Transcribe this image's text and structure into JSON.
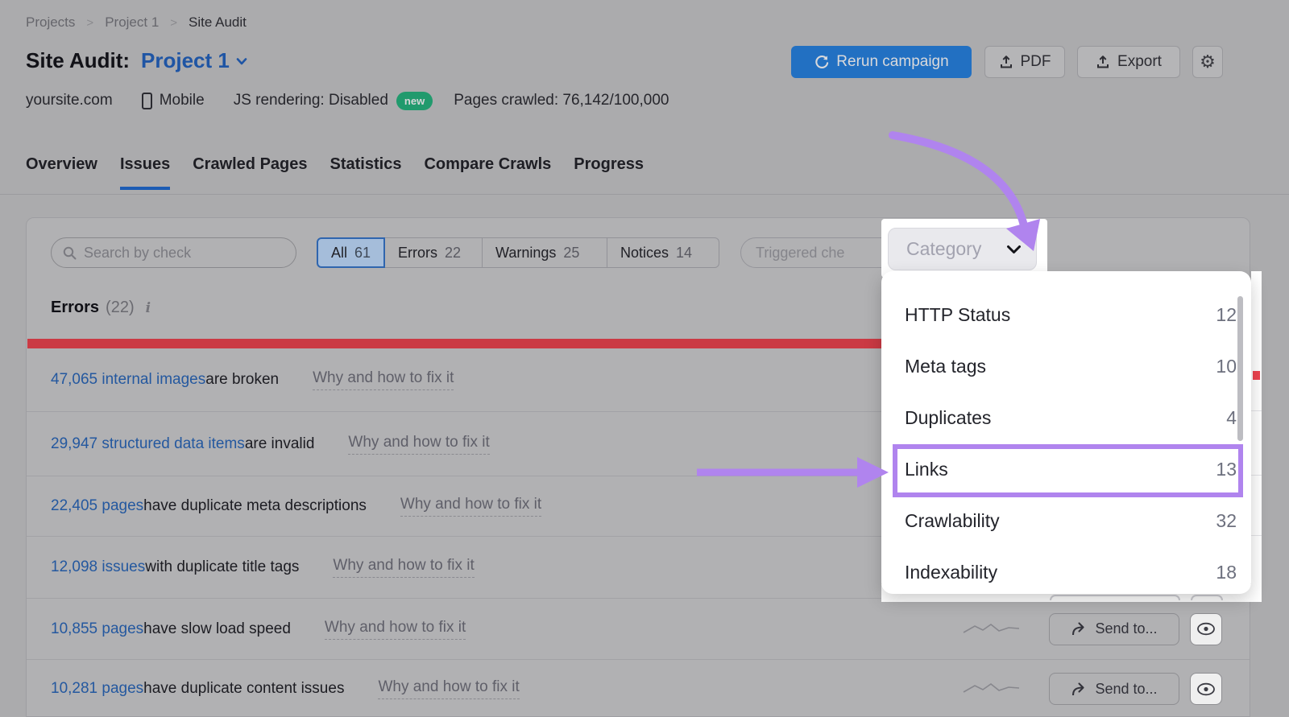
{
  "breadcrumb": {
    "items": [
      "Projects",
      "Project 1",
      "Site Audit"
    ]
  },
  "header": {
    "title_prefix": "Site Audit:",
    "project_name": "Project 1",
    "rerun_label": "Rerun campaign",
    "pdf_label": "PDF",
    "export_label": "Export"
  },
  "meta": {
    "domain": "yoursite.com",
    "device": "Mobile",
    "js_rendering": "JS rendering: Disabled",
    "new_badge": "new",
    "pages_crawled": "Pages crawled: 76,142/100,000"
  },
  "tabs": [
    {
      "label": "Overview",
      "active": false
    },
    {
      "label": "Issues",
      "active": true
    },
    {
      "label": "Crawled Pages",
      "active": false
    },
    {
      "label": "Statistics",
      "active": false
    },
    {
      "label": "Compare Crawls",
      "active": false
    },
    {
      "label": "Progress",
      "active": false
    }
  ],
  "filters": {
    "search_placeholder": "Search by check",
    "segments": [
      {
        "label": "All",
        "count": "61",
        "selected": true
      },
      {
        "label": "Errors",
        "count": "22",
        "selected": false
      },
      {
        "label": "Warnings",
        "count": "25",
        "selected": false
      },
      {
        "label": "Notices",
        "count": "14",
        "selected": false
      }
    ],
    "triggered_label": "Triggered che",
    "category_label": "Category"
  },
  "dropdown": {
    "items": [
      {
        "label": "HTTP Status",
        "count": "12",
        "highlighted": false
      },
      {
        "label": "Meta tags",
        "count": "10",
        "highlighted": false
      },
      {
        "label": "Duplicates",
        "count": "4",
        "highlighted": false
      },
      {
        "label": "Links",
        "count": "13",
        "highlighted": true
      },
      {
        "label": "Crawlability",
        "count": "32",
        "highlighted": false
      },
      {
        "label": "Indexability",
        "count": "18",
        "highlighted": false
      }
    ]
  },
  "errors": {
    "title": "Errors",
    "count": "(22)",
    "why_label": "Why and how to fix it",
    "send_label": "Send to...",
    "rows": [
      {
        "link": "47,065 internal images",
        "rest": " are broken"
      },
      {
        "link": "29,947 structured data items",
        "rest": " are invalid"
      },
      {
        "link": "22,405 pages",
        "rest": " have duplicate meta descriptions"
      },
      {
        "link": "12,098 issues",
        "rest": " with duplicate title tags"
      },
      {
        "link": "10,855 pages",
        "rest": " have slow load speed"
      },
      {
        "link": "10,281 pages",
        "rest": " have duplicate content issues"
      }
    ]
  },
  "colors": {
    "primary_button_blue": "#2270c2",
    "link_blue": "#24589f",
    "active_tab_blue": "#1d5cb4",
    "error_red": "#cb3a44",
    "badge_green": "#219a6d",
    "annotation_purple": "#b084ee",
    "selected_segment_blue": "#a5bdda",
    "dimmed_background": "#ababad"
  }
}
